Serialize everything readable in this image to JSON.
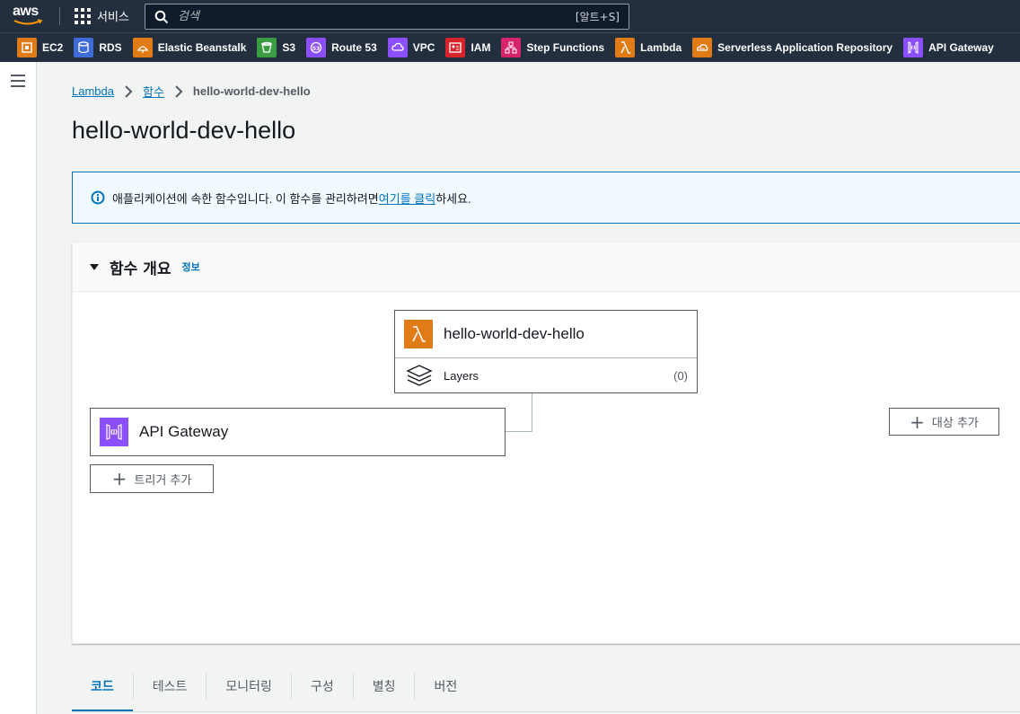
{
  "topnav": {
    "logo_text": "aws",
    "services_label": "서비스",
    "search_placeholder": "검색",
    "search_shortcut": "[알트+S]"
  },
  "favorites": [
    {
      "label": "EC2",
      "color": "#e07b15",
      "icon": "ec2-icon"
    },
    {
      "label": "RDS",
      "color": "#3f6bd6",
      "icon": "rds-icon"
    },
    {
      "label": "Elastic Beanstalk",
      "color": "#e07b15",
      "icon": "elastic-beanstalk-icon"
    },
    {
      "label": "S3",
      "color": "#3a9d41",
      "icon": "s3-icon"
    },
    {
      "label": "Route 53",
      "color": "#8c4fff",
      "icon": "route53-icon"
    },
    {
      "label": "VPC",
      "color": "#8c4fff",
      "icon": "vpc-icon"
    },
    {
      "label": "IAM",
      "color": "#d6242d",
      "icon": "iam-icon"
    },
    {
      "label": "Step Functions",
      "color": "#d6246c",
      "icon": "step-functions-icon"
    },
    {
      "label": "Lambda",
      "color": "#e07b15",
      "icon": "lambda-icon"
    },
    {
      "label": "Serverless Application Repository",
      "color": "#e07b15",
      "icon": "serverless-repo-icon"
    },
    {
      "label": "API Gateway",
      "color": "#8c4fff",
      "icon": "api-gateway-icon"
    }
  ],
  "breadcrumb": {
    "items": [
      "Lambda",
      "함수"
    ],
    "current": "hello-world-dev-hello"
  },
  "page": {
    "title": "hello-world-dev-hello"
  },
  "flash": {
    "text_before": "애플리케이션에 속한 함수입니다. 이 함수를 관리하려면 ",
    "link": "여기를 클릭",
    "text_after": "하세요."
  },
  "overview": {
    "title": "함수 개요",
    "info_link": "정보",
    "function_name": "hello-world-dev-hello",
    "layers_label": "Layers",
    "layers_count": "(0)",
    "trigger_name": "API Gateway",
    "add_trigger_label": "트리거 추가",
    "add_destination_label": "대상 추가"
  },
  "tabs": [
    "코드",
    "테스트",
    "모니터링",
    "구성",
    "별칭",
    "버전"
  ],
  "active_tab": "코드",
  "colors": {
    "nav_bg": "#232f3e",
    "link": "#0073bb",
    "lambda_orange": "#e07b15",
    "apigw_purple": "#8c4fff"
  }
}
